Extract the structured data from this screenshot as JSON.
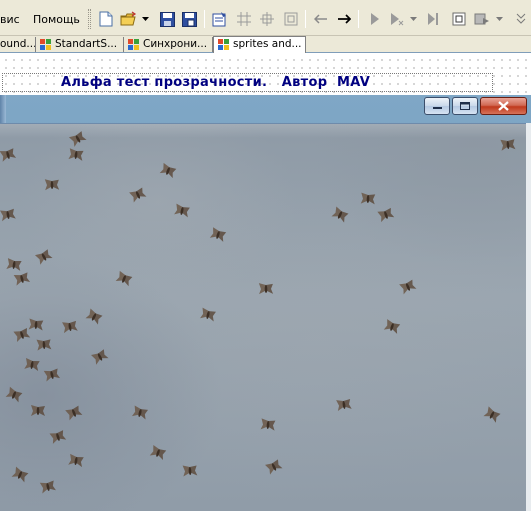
{
  "menu": {
    "items": [
      "вис",
      "Помощь"
    ]
  },
  "toolbar": {
    "buttons": [
      "new-file",
      "open-file",
      "open-dropdown",
      "save",
      "save-all",
      "tab-order",
      "grid",
      "align-center",
      "size-to-grid",
      "back",
      "forward",
      "run",
      "run-dropdown",
      "step",
      "debug-options",
      "debug-dropdown"
    ]
  },
  "tabs": [
    {
      "label": "ound..."
    },
    {
      "label": "StandartS..."
    },
    {
      "label": "Синхрони..."
    },
    {
      "label": "sprites and..."
    }
  ],
  "form": {
    "label_text": "Альфа тест прозрачности.   Автор  MAV"
  },
  "window_controls": {
    "minimize": "minimize-icon",
    "maximize": "maximize-icon",
    "close": "close-icon"
  },
  "colors": {
    "label_text": "#000080",
    "close_button": "#c0391c",
    "background_surface": "#8e9aa6",
    "sprite": "#6b5848"
  }
}
